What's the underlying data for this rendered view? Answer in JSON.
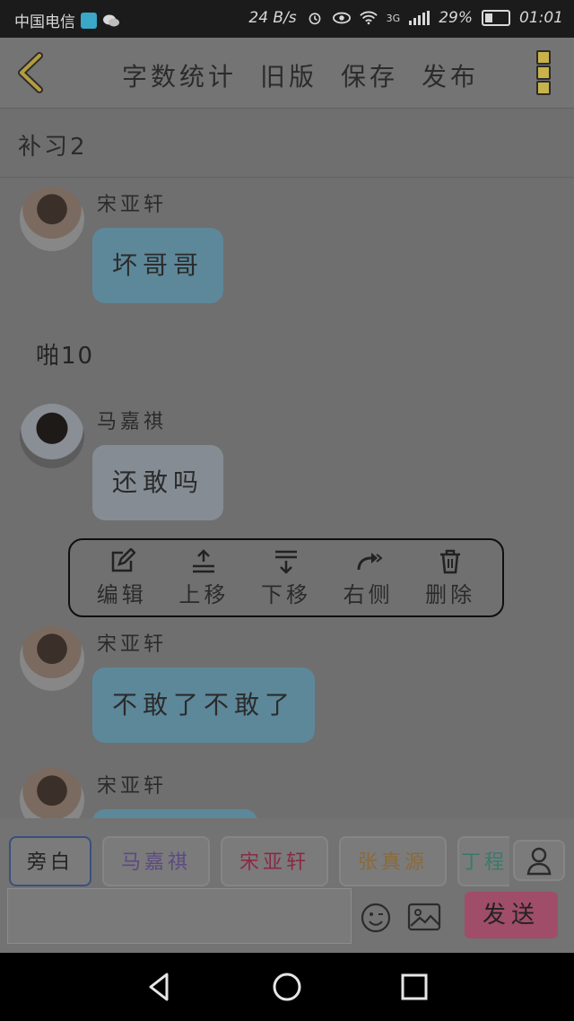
{
  "status_bar": {
    "carrier": "中国电信",
    "speed": "24 B/s",
    "network": "3G",
    "battery": "29%",
    "time": "01:01"
  },
  "toolbar": {
    "word_count": "字数统计",
    "old_version": "旧版",
    "save": "保存",
    "publish": "发布"
  },
  "document_title": "补习2",
  "messages": [
    {
      "sender": "宋亚轩",
      "text": "坏哥哥",
      "bubble_color": "#5d889a"
    },
    {
      "narration": "啪10"
    },
    {
      "sender": "马嘉祺",
      "text": "还敢吗",
      "bubble_color": "#858c94"
    },
    {
      "sender": "宋亚轩",
      "text": "不敢了不敢了",
      "bubble_color": "#5d889a"
    },
    {
      "sender": "宋亚轩"
    }
  ],
  "context_menu": {
    "edit": "编辑",
    "move_up": "上移",
    "move_down": "下移",
    "right_side": "右侧",
    "delete": "删除"
  },
  "roles": [
    {
      "label": "旁白",
      "color": "#2b2b2b"
    },
    {
      "label": "马嘉祺",
      "color": "#5c4a82"
    },
    {
      "label": "宋亚轩",
      "color": "#8a2a45"
    },
    {
      "label": "张真源",
      "color": "#8a6a3a"
    },
    {
      "label": "丁程",
      "color": "#3a7a6a"
    }
  ],
  "composer": {
    "input_value": "",
    "send": "发送"
  }
}
